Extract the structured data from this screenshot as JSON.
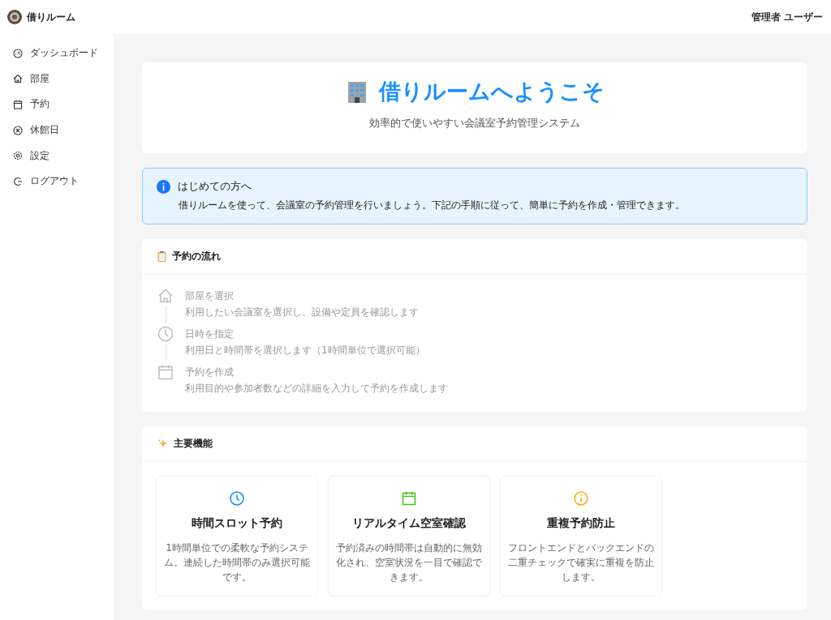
{
  "header": {
    "app_name": "借りルーム",
    "user": "管理者 ユーザー"
  },
  "sidebar": {
    "items": [
      {
        "label": "ダッシュボード",
        "kind": "dashboard"
      },
      {
        "label": "部屋",
        "kind": "home"
      },
      {
        "label": "予約",
        "kind": "calendar"
      },
      {
        "label": "休館日",
        "kind": "closed"
      },
      {
        "label": "設定",
        "kind": "settings"
      },
      {
        "label": "ログアウト",
        "kind": "logout"
      }
    ]
  },
  "welcome": {
    "title": "借りルームへようこそ",
    "subtitle": "効率的で使いやすい会議室予約管理システム"
  },
  "notice": {
    "title": "はじめての方へ",
    "text": "借りルームを使って、会議室の予約管理を行いましょう。下記の手順に従って、簡単に予約を作成・管理できます。"
  },
  "flow": {
    "title": "予約の流れ",
    "steps": [
      {
        "kind": "home",
        "title": "部屋を選択",
        "description": "利用したい会議室を選択し、設備や定員を確認します"
      },
      {
        "kind": "clock",
        "title": "日時を指定",
        "description": "利用日と時間帯を選択します（1時間単位で選択可能）"
      },
      {
        "kind": "calendar",
        "title": "予約を作成",
        "description": "利用目的や参加者数などの詳細を入力して予約を作成します"
      }
    ]
  },
  "features": {
    "title": "主要機能",
    "items": [
      {
        "kind": "clock",
        "color": "#1890ff",
        "title": "時間スロット予約",
        "description": "1時間単位での柔軟な予約システム。連続した時間帯のみ選択可能です。"
      },
      {
        "kind": "calendar",
        "color": "#52c41a",
        "title": "リアルタイム空室確認",
        "description": "予約済みの時間帯は自動的に無効化され、空室状況を一目で確認できます。"
      },
      {
        "kind": "info",
        "color": "#faad14",
        "title": "重複予約防止",
        "description": "フロントエンドとバックエンドの二重チェックで確実に重複を防止します。"
      }
    ]
  }
}
